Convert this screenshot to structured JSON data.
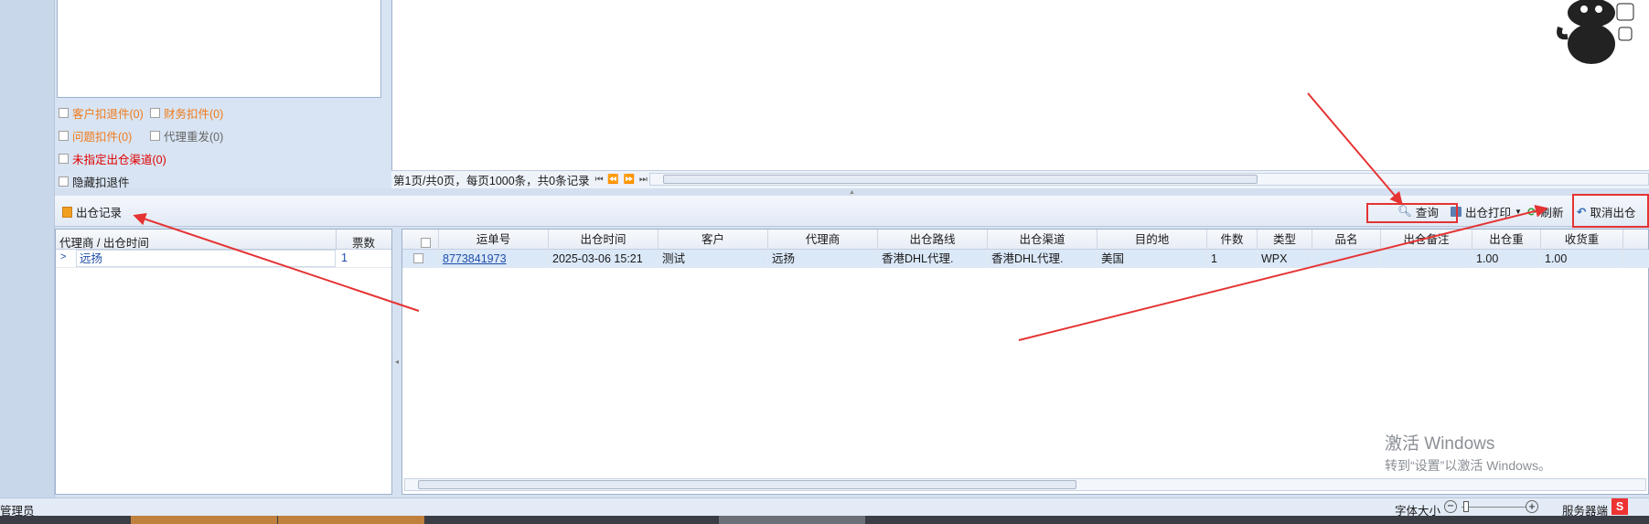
{
  "filters": [
    {
      "label": "客户扣退件(0)",
      "color": "orange"
    },
    {
      "label": "财务扣件(0)",
      "color": "orange"
    },
    {
      "label": "问题扣件(0)",
      "color": "orange"
    },
    {
      "label": "代理重发(0)",
      "color": "gray"
    },
    {
      "label": "未指定出仓渠道(0)",
      "color": "red"
    },
    {
      "label": "隐藏扣退件",
      "color": "black"
    }
  ],
  "pager": {
    "text": "第1页/共0页，每页1000条，共0条记录",
    "nav": "⏮ ⏪ ⏩ ⏭"
  },
  "toolbar": {
    "section_title": "出仓记录",
    "query": "查询",
    "print": "出仓打印",
    "refresh": "刷新",
    "cancel": "取消出仓"
  },
  "left_grid": {
    "columns": [
      "代理商 / 出仓时间",
      "票数"
    ],
    "rows": [
      {
        "agent": "远扬",
        "count": "1"
      }
    ]
  },
  "main_grid": {
    "columns": [
      "运单号",
      "出仓时间",
      "客户",
      "代理商",
      "出仓路线",
      "出仓渠道",
      "目的地",
      "件数",
      "类型",
      "品名",
      "出仓备注",
      "出仓重",
      "收货重"
    ],
    "rows": [
      {
        "waybill": "8773841973",
        "time": "2025-03-06 15:21",
        "customer": "测试",
        "agent": "远扬",
        "route": "香港DHL代理.",
        "channel": "香港DHL代理.",
        "dest": "美国",
        "pieces": "1",
        "type": "WPX",
        "product": "",
        "remark": "",
        "out_weight": "1.00",
        "recv_weight": "1.00"
      }
    ]
  },
  "watermark": {
    "title": "激活 Windows",
    "sub": "转到“设置”以激活 Windows。"
  },
  "status": {
    "user": "管理员",
    "font_size": "字体大小",
    "server": "服务器端"
  },
  "colors": {
    "annotation_red": "#e53333",
    "accent_blue": "#1f4fa8"
  }
}
